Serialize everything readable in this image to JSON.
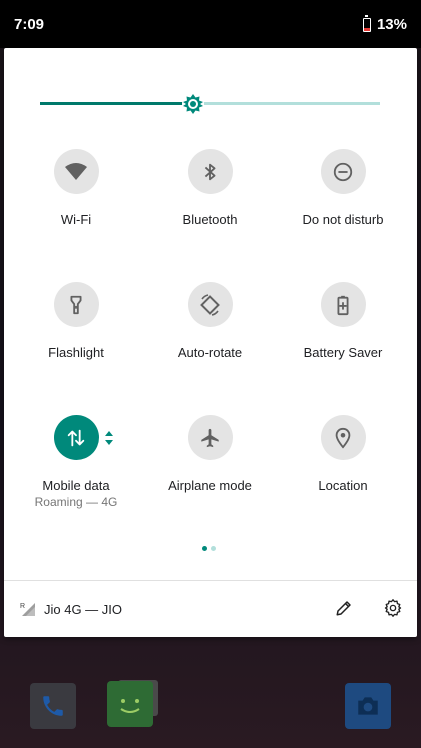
{
  "status_bar": {
    "time": "7:09",
    "battery": "13%"
  },
  "brightness": {
    "level": 0.45
  },
  "tiles": [
    {
      "label": "Wi-Fi",
      "icon": "wifi-icon"
    },
    {
      "label": "Bluetooth",
      "icon": "bluetooth-icon"
    },
    {
      "label": "Do not disturb",
      "icon": "do-not-disturb-icon"
    },
    {
      "label": "Flashlight",
      "icon": "flashlight-icon"
    },
    {
      "label": "Auto-rotate",
      "icon": "auto-rotate-icon"
    },
    {
      "label": "Battery Saver",
      "icon": "battery-saver-icon"
    },
    {
      "label": "Mobile data",
      "sub": "Roaming — 4G",
      "icon": "mobile-data-icon",
      "active": true
    },
    {
      "label": "Airplane mode",
      "icon": "airplane-icon"
    },
    {
      "label": "Location",
      "icon": "location-icon"
    }
  ],
  "pagination": {
    "current": 1,
    "total": 2
  },
  "footer": {
    "carrier": "Jio 4G — JIO",
    "roaming_indicator": "R"
  },
  "colors": {
    "accent": "#00897b",
    "accent_light": "#b2dfdb",
    "tile_bg": "#e4e4e4"
  }
}
